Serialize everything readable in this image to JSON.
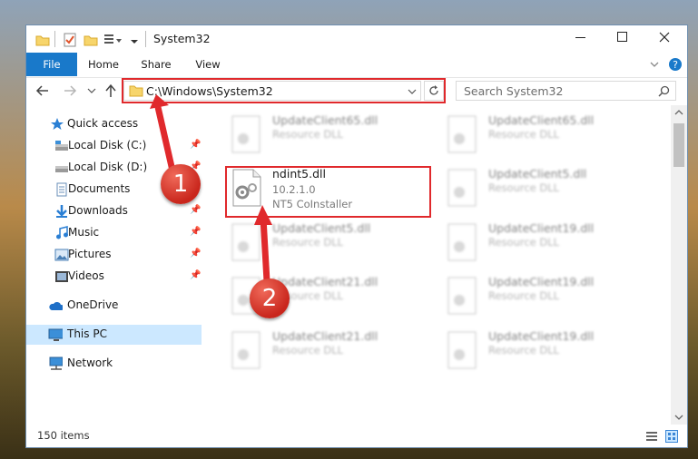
{
  "window": {
    "title": "System32"
  },
  "ribbon": {
    "tabs": [
      "File",
      "Home",
      "Share",
      "View"
    ]
  },
  "address": {
    "path": "C:\\Windows\\System32"
  },
  "search": {
    "placeholder": "Search System32"
  },
  "sidebar": {
    "items": [
      {
        "label": "Quick access",
        "icon": "star-icon",
        "pinned": false
      },
      {
        "label": "Local Disk (C:)",
        "icon": "disk-icon",
        "pinned": true
      },
      {
        "label": "Local Disk (D:)",
        "icon": "disk-icon",
        "pinned": true
      },
      {
        "label": "Documents",
        "icon": "documents-icon",
        "pinned": true
      },
      {
        "label": "Downloads",
        "icon": "download-icon",
        "pinned": true
      },
      {
        "label": "Music",
        "icon": "music-icon",
        "pinned": true
      },
      {
        "label": "Pictures",
        "icon": "pictures-icon",
        "pinned": true
      },
      {
        "label": "Videos",
        "icon": "videos-icon",
        "pinned": true
      },
      {
        "label": "OneDrive",
        "icon": "cloud-icon",
        "pinned": false
      },
      {
        "label": "This PC",
        "icon": "computer-icon",
        "pinned": false
      },
      {
        "label": "Network",
        "icon": "network-icon",
        "pinned": false
      }
    ]
  },
  "files": {
    "highlighted": {
      "name": "ndint5.dll",
      "version": "10.2.1.0",
      "description": "NT5 CoInstaller"
    },
    "blurred": [
      {
        "name": "UpdateClient65.dll",
        "description": "Resource DLL"
      },
      {
        "name": "UpdateClient65.dll",
        "description": "Resource DLL"
      },
      {
        "name": "UpdateClient5.dll",
        "description": "Resource DLL"
      },
      {
        "name": "UpdateClient5.dll",
        "description": "Resource DLL"
      },
      {
        "name": "UpdateClient19.dll",
        "description": "Resource DLL"
      },
      {
        "name": "UpdateClient21.dll",
        "description": "Resource DLL"
      },
      {
        "name": "UpdateClient19.dll",
        "description": "Resource DLL"
      },
      {
        "name": "UpdateClient21.dll",
        "description": "Resource DLL"
      },
      {
        "name": "UpdateClient19.dll",
        "description": "Resource DLL"
      }
    ]
  },
  "status": {
    "count": "150 items"
  },
  "annotations": {
    "badge1": "1",
    "badge2": "2",
    "accent": "#e0292c"
  }
}
